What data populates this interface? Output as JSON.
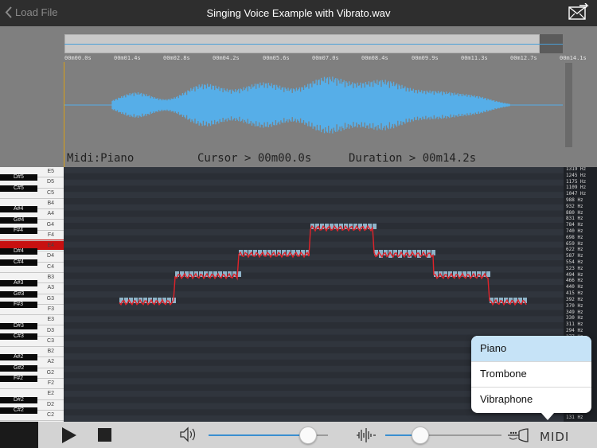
{
  "topbar": {
    "back_label": "Load File",
    "title": "Singing Voice Example with Vibrato.wav"
  },
  "timeline": {
    "ticks": [
      "00m00.0s",
      "00m01.4s",
      "00m02.8s",
      "00m04.2s",
      "00m05.6s",
      "00m07.0s",
      "00m08.4s",
      "00m09.9s",
      "00m11.3s",
      "00m12.7s",
      "00m14.1s"
    ]
  },
  "info": {
    "instrument": "Midi:Piano",
    "cursor": "Cursor > 00m00.0s",
    "duration": "Duration > 00m14.2s"
  },
  "piano": {
    "white_labels": [
      "E5",
      "D5",
      "C5",
      "B4",
      "A4",
      "G4",
      "F4",
      "E4",
      "D4",
      "C4",
      "B3",
      "A3",
      "G3",
      "F3",
      "E3",
      "D3",
      "C3",
      "B2",
      "A2",
      "G2",
      "F2",
      "E2",
      "D2",
      "C2"
    ],
    "black_labels": [
      "D#5",
      "C#5",
      "A#4",
      "G#4",
      "F#4",
      "D#4",
      "C#4",
      "A#3",
      "G#3",
      "F#3",
      "D#3",
      "C#3",
      "A#2",
      "G#2",
      "F#2",
      "D#2",
      "C#2"
    ]
  },
  "freq_labels": [
    "1319 Hz",
    "1245 Hz",
    "1175 Hz",
    "1109 Hz",
    "1047 Hz",
    "988 Hz",
    "932 Hz",
    "880 Hz",
    "831 Hz",
    "784 Hz",
    "740 Hz",
    "698 Hz",
    "659 Hz",
    "622 Hz",
    "587 Hz",
    "554 Hz",
    "523 Hz",
    "494 Hz",
    "466 Hz",
    "440 Hz",
    "415 Hz",
    "392 Hz",
    "370 Hz",
    "349 Hz",
    "330 Hz",
    "311 Hz",
    "294 Hz",
    "277 Hz",
    "262 Hz",
    "247 Hz",
    "233 Hz",
    "220 Hz",
    "208 Hz",
    "196 Hz",
    "185 Hz",
    "175 Hz",
    "165 Hz",
    "156 Hz",
    "147 Hz",
    "139 Hz",
    "131 Hz"
  ],
  "controls": {
    "volume_level": 0.83,
    "sensitivity_level": 0.3
  },
  "instrument_menu": {
    "options": [
      "Piano",
      "Trombone",
      "Vibraphone"
    ],
    "selected": "Piano"
  },
  "colors": {
    "accent": "#3a8fd0",
    "waveform": "#56aee8",
    "pitch_line": "#e0232a",
    "note_block": "#8fb3c8",
    "cursor": "#d9a016"
  }
}
